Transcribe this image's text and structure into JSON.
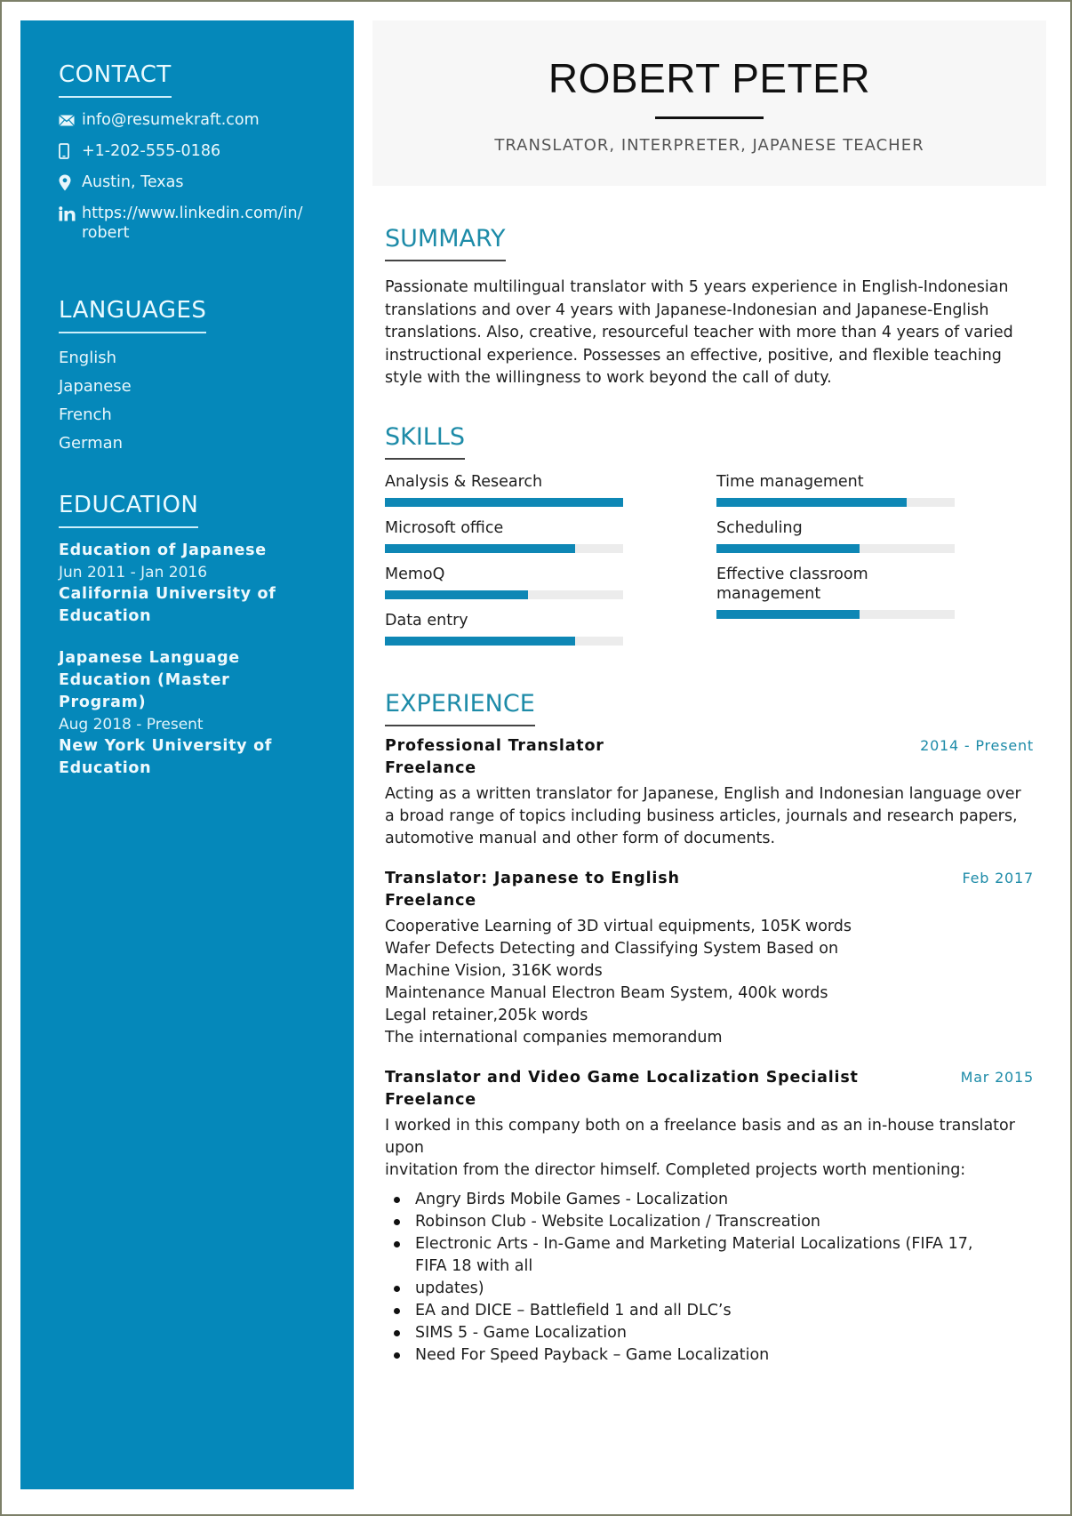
{
  "header": {
    "name": "ROBERT PETER",
    "tagline": "TRANSLATOR, INTERPRETER, JAPANESE TEACHER"
  },
  "sidebar": {
    "contact": {
      "title": "CONTACT",
      "items": [
        {
          "icon": "envelope-icon",
          "text": "info@resumekraft.com"
        },
        {
          "icon": "mobile-phone-icon",
          "text": "+1-202-555-0186"
        },
        {
          "icon": "location-pin-icon",
          "text": "Austin, Texas"
        },
        {
          "icon": "linkedin-icon",
          "text": "https://www.linkedin.com/in/robert"
        }
      ]
    },
    "languages": {
      "title": "LANGUAGES",
      "items": [
        "English",
        "Japanese",
        "French",
        "German"
      ]
    },
    "education": {
      "title": "EDUCATION",
      "items": [
        {
          "degree": "Education of Japanese",
          "dates": "Jun 2011 - Jan 2016",
          "school": "California University of Education"
        },
        {
          "degree": "Japanese Language Education (Master Program)",
          "dates": "Aug 2018 - Present",
          "school": "New York University of Education"
        }
      ]
    }
  },
  "summary": {
    "title": "SUMMARY",
    "text": "Passionate multilingual translator with 5 years experience in English-Indonesian translations and over 4 years with Japanese-Indonesian and Japanese-English translations. Also, creative, resourceful teacher with more than 4 years of varied instructional experience. Possesses an effective, positive, and flexible teaching style with the willingness to work beyond the call of duty."
  },
  "skills": {
    "title": "SKILLS",
    "items": [
      {
        "label": "Analysis & Research",
        "level": 1.0
      },
      {
        "label": "Microsoft office",
        "level": 0.8
      },
      {
        "label": "MemoQ",
        "level": 0.6
      },
      {
        "label": "Data entry",
        "level": 0.8
      },
      {
        "label": "Time management",
        "level": 0.8
      },
      {
        "label": "Scheduling",
        "level": 0.6
      },
      {
        "label": "Effective classroom management",
        "level": 0.6
      }
    ]
  },
  "experience": {
    "title": "EXPERIENCE",
    "jobs": [
      {
        "title": "Professional Translator",
        "company": "Freelance",
        "date": "2014 - Present",
        "description": "Acting as a written translator for Japanese, English and Indonesian language over a broad range of topics including business articles, journals and research papers, automotive manual and other form of documents."
      },
      {
        "title": "Translator: Japanese to English",
        "company": "Freelance",
        "date": "Feb 2017",
        "lines": [
          "Cooperative Learning of 3D virtual equipments, 105K words",
          "Wafer Defects Detecting and Classifying System Based on",
          "Machine Vision, 316K words",
          "Maintenance Manual Electron Beam System, 400k words",
          "Legal retainer,205k words",
          "The international companies memorandum"
        ]
      },
      {
        "title": "Translator and Video Game Localization Specialist",
        "company": "Freelance",
        "date": "Mar 2015",
        "description_lines": [
          "I worked in this company both on a freelance basis and as an in-house translator",
          "upon",
          "invitation from the director himself. Completed projects worth mentioning:"
        ],
        "bullets": [
          "Angry Birds Mobile Games - Localization",
          "Robinson Club - Website Localization / Transcreation",
          "Electronic Arts - In-Game and Marketing Material Localizations (FIFA 17, FIFA 18 with all",
          "updates)",
          "EA and DICE – Battlefield 1 and all DLC’s",
          "SIMS 5 - Game Localization",
          "Need For Speed Payback – Game Localization"
        ]
      }
    ]
  },
  "colors": {
    "sidebar_bg": "#0588ba",
    "accent": "#1d8ba8",
    "skill_fill": "#0e87b5",
    "skill_track": "#ececec",
    "header_bg": "#f7f7f7"
  }
}
